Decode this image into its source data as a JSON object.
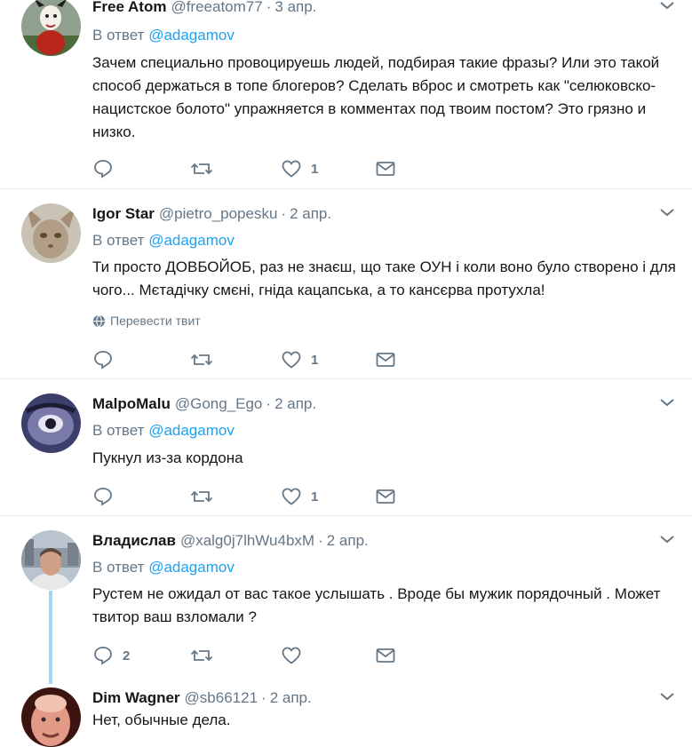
{
  "tweets": [
    {
      "name": "Free Atom",
      "handle": "@freeatom77",
      "sep": "·",
      "time": "3 апр.",
      "reply_prefix": "В ответ",
      "reply_to": "@adagamov",
      "text": "Зачем специально провоцируешь людей, подбирая такие фразы? Или это такой способ держаться в топе блогеров? Сделать вброс и смотреть   как \"селюковско-нацистское болото\" упражняется в комментах под твоим постом? Это грязно и низко.",
      "reply_count": "",
      "retweet_count": "",
      "like_count": "1"
    },
    {
      "name": "Igor Star",
      "handle": "@pietro_popesku",
      "sep": "·",
      "time": "2 апр.",
      "reply_prefix": "В ответ",
      "reply_to": "@adagamov",
      "text": "Ти просто ДОВБОЙОБ, раз не знаєш, що таке ОУН і коли воно було створено і для чого... Мєтадічку смєні, гніда кацапська, а то кансєрва протухла!",
      "translate": "Перевести твит",
      "reply_count": "",
      "retweet_count": "",
      "like_count": "1"
    },
    {
      "name": "MalpoMalu",
      "handle": "@Gong_Ego",
      "sep": "·",
      "time": "2 апр.",
      "reply_prefix": "В ответ",
      "reply_to": "@adagamov",
      "text": "Пукнул из-за кордона",
      "reply_count": "",
      "retweet_count": "",
      "like_count": "1"
    },
    {
      "name": "Владислав",
      "handle": "@xalg0j7lhWu4bxM",
      "sep": "·",
      "time": "2 апр.",
      "reply_prefix": "В ответ",
      "reply_to": "@adagamov",
      "text": "Рустем не ожидал от вас такое услышать . Вроде бы мужик порядочный . Может твитор ваш взломали ?",
      "reply_count": "2",
      "retweet_count": "",
      "like_count": ""
    },
    {
      "name": "Dim Wagner",
      "handle": "@sb66121",
      "sep": "·",
      "time": "2 апр.",
      "text": "Нет, обычные дела."
    }
  ],
  "colors": {
    "link": "#1da1f2",
    "secondary": "#657786",
    "divider": "#e6ecf0",
    "thread": "#a6d6f5"
  },
  "icons": [
    "reply-icon",
    "retweet-icon",
    "like-icon",
    "dm-icon",
    "chevron-down-icon",
    "globe-icon"
  ]
}
